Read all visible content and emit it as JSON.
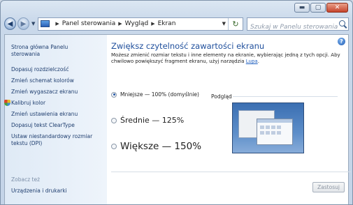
{
  "nav": {
    "breadcrumb": [
      "Panel sterowania",
      "Wygląd",
      "Ekran"
    ],
    "search_placeholder": "Szukaj w Panelu sterowania"
  },
  "sidebar": {
    "items": [
      {
        "label": "Strona główna Panelu\nsterowania"
      },
      {
        "label": "Dopasuj rozdzielczość"
      },
      {
        "label": "Zmień schemat kolorów"
      },
      {
        "label": "Zmień wygaszacz ekranu"
      },
      {
        "label": "Kalibruj kolor"
      },
      {
        "label": "Zmień ustawienia ekranu"
      },
      {
        "label": "Dopasuj tekst ClearType"
      },
      {
        "label": "Ustaw niestandardowy rozmiar\ntekstu (DPI)"
      }
    ],
    "see_also": "Zobacz też",
    "see_also_items": [
      {
        "label": "Urządzenia i drukarki"
      }
    ]
  },
  "main": {
    "title": "Zwiększ czytelność zawartości ekranu",
    "description": "Możesz zmienić rozmiar tekstu i inne elementy na ekranie, wybierając jedną z tych opcji. Aby chwilowo powiększyć fragment ekranu, użyj narzędzia ",
    "magnifier_link": "Lupa",
    "description_end": ".",
    "options": [
      {
        "label": "Mniejsze — 100% (domyślnie)",
        "selected": true
      },
      {
        "label": "Średnie — 125%",
        "selected": false
      },
      {
        "label": "Większe — 150%",
        "selected": false
      }
    ],
    "preview_label": "Podgląd",
    "apply_label": "Zastosuj"
  },
  "icons": {
    "help": "help-icon",
    "back": "back-arrow-icon",
    "forward": "forward-arrow-icon",
    "refresh": "refresh-icon",
    "search": "search-icon",
    "calibrate": "color-calibration-icon"
  },
  "colors": {
    "title": "#1f4f9c",
    "link": "#1e3d6e",
    "close": "#c6442c"
  }
}
